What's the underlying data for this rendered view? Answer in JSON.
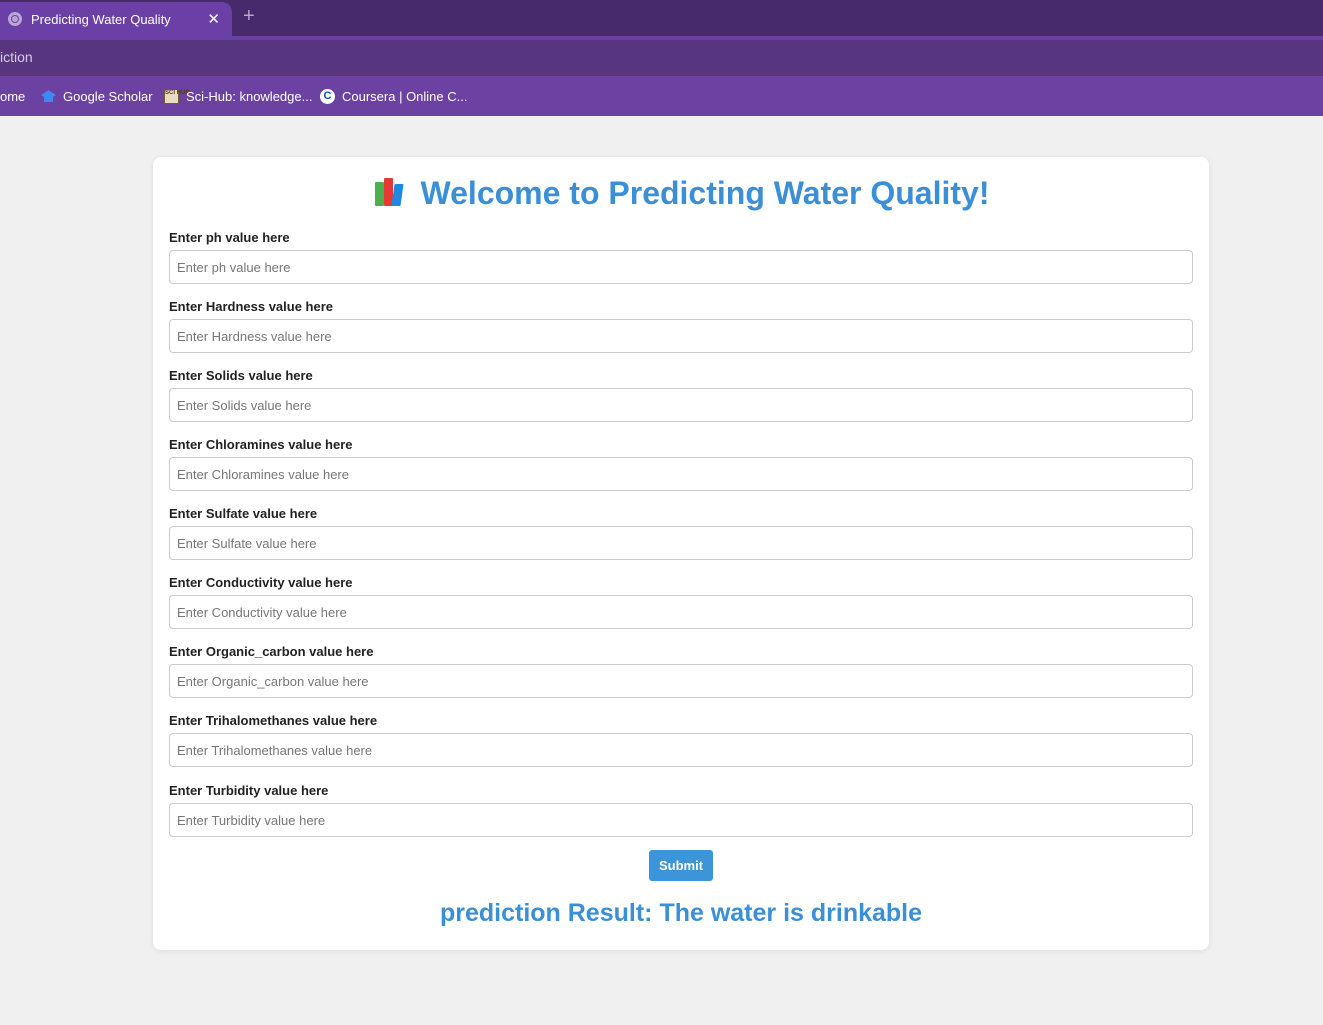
{
  "browser": {
    "tab_title": "Predicting Water Quality",
    "tab_close": "✕",
    "new_tab": "+",
    "url_fragment": "iction",
    "bookmarks": [
      {
        "label": "ome",
        "icon": "none"
      },
      {
        "label": "Google Scholar",
        "icon": "google-scholar-icon"
      },
      {
        "label": "Sci-Hub: knowledge...",
        "icon": "sci-hub-icon"
      },
      {
        "label": "Coursera | Online C...",
        "icon": "coursera-icon"
      }
    ],
    "scihub_icon_text": "SCI HUB",
    "coursera_icon_text": "C"
  },
  "page": {
    "title": "Welcome to Predicting Water Quality!",
    "fields": [
      {
        "label": "Enter ph value here",
        "placeholder": "Enter ph value here"
      },
      {
        "label": "Enter Hardness value here",
        "placeholder": "Enter Hardness value here"
      },
      {
        "label": "Enter Solids value here",
        "placeholder": "Enter Solids value here"
      },
      {
        "label": "Enter Chloramines value here",
        "placeholder": "Enter Chloramines value here"
      },
      {
        "label": "Enter Sulfate value here",
        "placeholder": "Enter Sulfate value here"
      },
      {
        "label": "Enter Conductivity value here",
        "placeholder": "Enter Conductivity value here"
      },
      {
        "label": "Enter Organic_carbon value here",
        "placeholder": "Enter Organic_carbon value here"
      },
      {
        "label": "Enter Trihalomethanes value here",
        "placeholder": "Enter Trihalomethanes value here"
      },
      {
        "label": "Enter Turbidity value here",
        "placeholder": "Enter Turbidity value here"
      }
    ],
    "submit_label": "Submit",
    "result_prefix": "prediction Result:",
    "result_value": "The water is drinkable"
  },
  "colors": {
    "accent": "#3b8fd6",
    "tab_bar": "#462a6b",
    "bookmarks_bar": "#6b42a2"
  }
}
